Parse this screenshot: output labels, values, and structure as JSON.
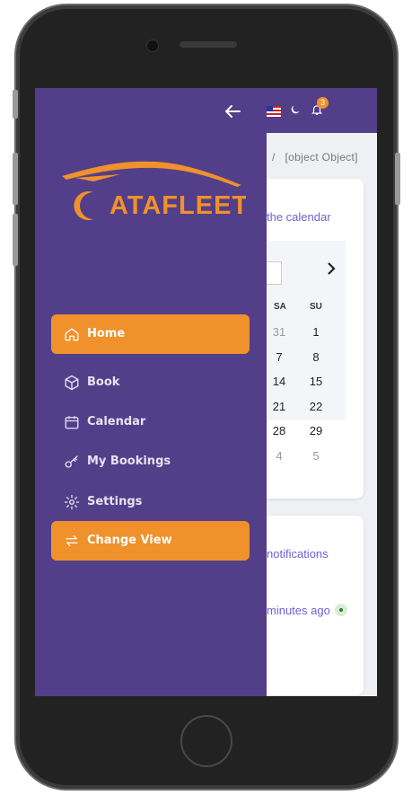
{
  "header": {
    "notification_count": "3",
    "flag_icon": "us-flag-icon",
    "theme_icon": "moon-icon",
    "bell_icon": "bell-icon"
  },
  "breadcrumb": {
    "separator": "/",
    "current": "[object Object]"
  },
  "calendar_card": {
    "link": "the calendar",
    "weekday_headers": [
      "SA",
      "SU"
    ],
    "weeks": [
      [
        "31",
        "1"
      ],
      [
        "7",
        "8"
      ],
      [
        "14",
        "15"
      ],
      [
        "21",
        "22"
      ],
      [
        "28",
        "29"
      ],
      [
        "4",
        "5"
      ]
    ]
  },
  "notifications_card": {
    "link": "notifications",
    "time": "minutes ago"
  },
  "drawer": {
    "logo_text": "ATAFLEET",
    "items": [
      {
        "label": "Home",
        "icon": "home-icon",
        "active": true
      },
      {
        "label": "Book",
        "icon": "box-icon",
        "active": false
      },
      {
        "label": "Calendar",
        "icon": "calendar-icon",
        "active": false
      },
      {
        "label": "My Bookings",
        "icon": "key-icon",
        "active": false
      },
      {
        "label": "Settings",
        "icon": "gear-icon",
        "active": false
      },
      {
        "label": "Change View",
        "icon": "swap-icon",
        "active": true
      }
    ]
  },
  "colors": {
    "drawer": "#533e8a",
    "accent": "#f0912b",
    "link": "#6b63d6"
  }
}
